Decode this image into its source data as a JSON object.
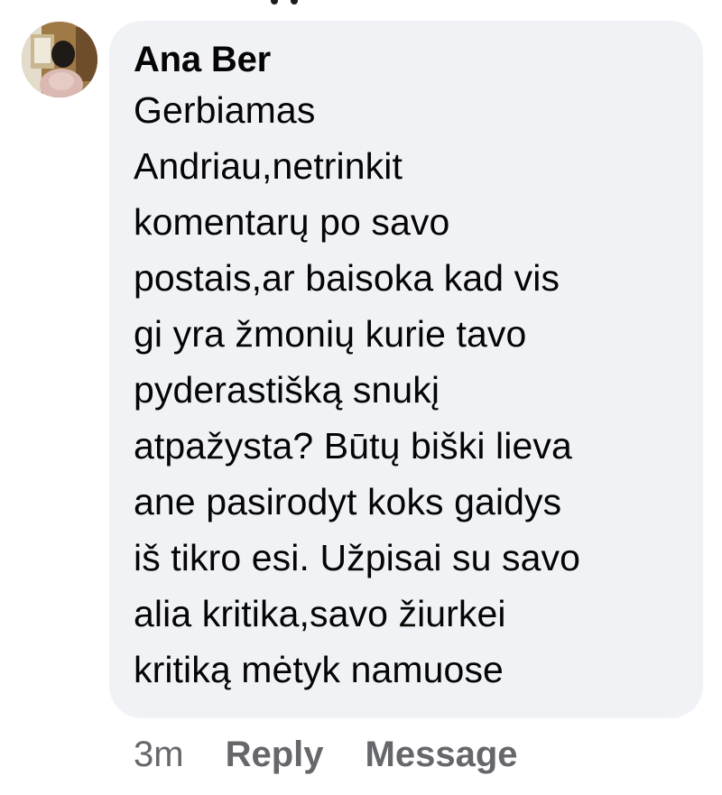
{
  "comment": {
    "author": "Ana Ber",
    "text_lines": [
      "Gerbiamas",
      "Andriau,netrinkit",
      "komentarų po savo",
      "postais,ar baisoka kad vis",
      "gi yra žmonių kurie tavo",
      "pyderastišką snukį",
      "atpažysta? Būtų biški lieva",
      "ane pasirodyt koks gaidys",
      "iš tikro esi. Užpisai su savo",
      "alia kritika,savo žiurkei",
      "kritiką mėtyk namuose"
    ],
    "time": "3m",
    "reply_label": "Reply",
    "message_label": "Message"
  },
  "colors": {
    "bubble_background": "#f0f2f5",
    "text": "#050505",
    "secondary_text": "#65676b"
  }
}
